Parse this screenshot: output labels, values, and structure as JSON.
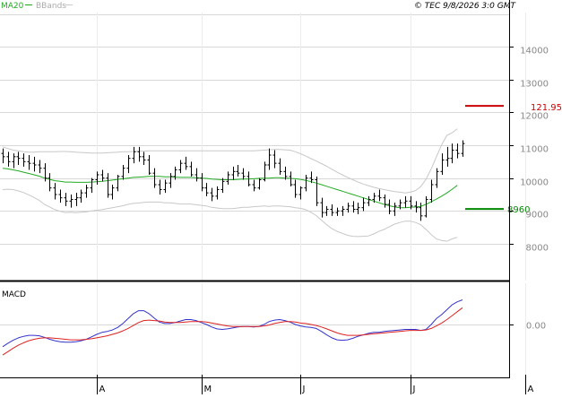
{
  "header": {
    "legend": [
      {
        "name": "MA20",
        "color": "#22aa22"
      },
      {
        "name": "BBands",
        "color": "#bbbbbb"
      }
    ],
    "watermark": "© TEC 9/8/2026 3:0 GMT"
  },
  "chart_data": [
    {
      "type": "ohlc",
      "panel": "price",
      "ylim": [
        7500,
        15000
      ],
      "y_ticks": [
        {
          "v": 8000,
          "label": "8000"
        },
        {
          "v": 9000,
          "label": "9000"
        },
        {
          "v": 10000,
          "label": "10000"
        },
        {
          "v": 11000,
          "label": "11000"
        },
        {
          "v": 12000,
          "label": "12000"
        },
        {
          "v": 13000,
          "label": "13000"
        },
        {
          "v": 14000,
          "label": "14000"
        }
      ],
      "x_ticks": [
        {
          "index": 18,
          "label": "A"
        },
        {
          "index": 38,
          "label": "M"
        },
        {
          "index": 57,
          "label": "J"
        },
        {
          "index": 78,
          "label": "J"
        },
        {
          "index": 100,
          "label": "A"
        }
      ],
      "ohlc": [
        [
          10750,
          10900,
          10450,
          10650
        ],
        [
          10650,
          10800,
          10350,
          10500
        ],
        [
          10500,
          10750,
          10300,
          10650
        ],
        [
          10650,
          10800,
          10400,
          10600
        ],
        [
          10600,
          10750,
          10350,
          10500
        ],
        [
          10500,
          10700,
          10250,
          10450
        ],
        [
          10450,
          10650,
          10200,
          10400
        ],
        [
          10400,
          10550,
          10150,
          10300
        ],
        [
          10300,
          10450,
          9900,
          10000
        ],
        [
          10000,
          10150,
          9600,
          9700
        ],
        [
          9700,
          9850,
          9350,
          9500
        ],
        [
          9500,
          9650,
          9250,
          9400
        ],
        [
          9400,
          9550,
          9150,
          9300
        ],
        [
          9300,
          9500,
          9100,
          9350
        ],
        [
          9350,
          9550,
          9150,
          9400
        ],
        [
          9400,
          9650,
          9250,
          9550
        ],
        [
          9550,
          9800,
          9400,
          9700
        ],
        [
          9700,
          10000,
          9550,
          9950
        ],
        [
          9950,
          10200,
          9800,
          10100
        ],
        [
          10100,
          10250,
          9900,
          10000
        ],
        [
          10000,
          10150,
          9400,
          9500
        ],
        [
          9500,
          9800,
          9350,
          9700
        ],
        [
          9700,
          10100,
          9600,
          10050
        ],
        [
          10050,
          10400,
          9950,
          10300
        ],
        [
          10300,
          10700,
          10150,
          10600
        ],
        [
          10600,
          10950,
          10450,
          10800
        ],
        [
          10800,
          10950,
          10500,
          10650
        ],
        [
          10650,
          10800,
          10400,
          10550
        ],
        [
          10550,
          10700,
          10100,
          10150
        ],
        [
          10150,
          10300,
          9700,
          9800
        ],
        [
          9800,
          9950,
          9500,
          9650
        ],
        [
          9650,
          9950,
          9550,
          9850
        ],
        [
          9850,
          10150,
          9700,
          10050
        ],
        [
          10050,
          10350,
          9950,
          10250
        ],
        [
          10250,
          10550,
          10150,
          10450
        ],
        [
          10450,
          10650,
          10250,
          10350
        ],
        [
          10350,
          10500,
          10050,
          10100
        ],
        [
          10100,
          10300,
          9900,
          10000
        ],
        [
          10000,
          10150,
          9600,
          9700
        ],
        [
          9700,
          9850,
          9450,
          9550
        ],
        [
          9550,
          9700,
          9300,
          9450
        ],
        [
          9450,
          9750,
          9350,
          9650
        ],
        [
          9650,
          10000,
          9550,
          9900
        ],
        [
          9900,
          10200,
          9800,
          10100
        ],
        [
          10100,
          10350,
          9950,
          10200
        ],
        [
          10200,
          10400,
          10050,
          10150
        ],
        [
          10150,
          10300,
          9950,
          10050
        ],
        [
          10050,
          10200,
          9750,
          9800
        ],
        [
          9800,
          9950,
          9600,
          9700
        ],
        [
          9700,
          10000,
          9650,
          9950
        ],
        [
          9950,
          10500,
          9900,
          10400
        ],
        [
          10400,
          10900,
          10250,
          10700
        ],
        [
          10700,
          10850,
          10300,
          10450
        ],
        [
          10450,
          10600,
          10100,
          10200
        ],
        [
          10200,
          10350,
          9950,
          10050
        ],
        [
          10050,
          10200,
          9750,
          9800
        ],
        [
          9800,
          9950,
          9400,
          9500
        ],
        [
          9500,
          9750,
          9350,
          9700
        ],
        [
          9700,
          10100,
          9600,
          10000
        ],
        [
          10000,
          10200,
          9850,
          9950
        ],
        [
          9950,
          10050,
          9150,
          9250
        ],
        [
          9250,
          9400,
          8800,
          8950
        ],
        [
          8950,
          9150,
          8850,
          9050
        ],
        [
          9050,
          9200,
          8850,
          8950
        ],
        [
          8950,
          9100,
          8850,
          9000
        ],
        [
          9000,
          9150,
          8850,
          9050
        ],
        [
          9050,
          9250,
          8950,
          9150
        ],
        [
          9150,
          9300,
          8950,
          9050
        ],
        [
          9050,
          9250,
          8900,
          9100
        ],
        [
          9100,
          9400,
          9000,
          9250
        ],
        [
          9250,
          9450,
          9150,
          9350
        ],
        [
          9350,
          9550,
          9250,
          9450
        ],
        [
          9450,
          9650,
          9300,
          9400
        ],
        [
          9400,
          9500,
          9100,
          9200
        ],
        [
          9200,
          9350,
          8900,
          9000
        ],
        [
          9000,
          9250,
          8850,
          9150
        ],
        [
          9150,
          9350,
          9050,
          9250
        ],
        [
          9250,
          9450,
          9100,
          9300
        ],
        [
          9300,
          9450,
          9050,
          9150
        ],
        [
          9150,
          9300,
          8950,
          9100
        ],
        [
          9100,
          9250,
          8700,
          8850
        ],
        [
          8850,
          9450,
          8800,
          9350
        ],
        [
          9350,
          9950,
          9250,
          9800
        ],
        [
          9800,
          10300,
          9700,
          10200
        ],
        [
          10200,
          10750,
          10100,
          10550
        ],
        [
          10550,
          10950,
          10350,
          10600
        ],
        [
          10600,
          11050,
          10450,
          10850
        ],
        [
          10850,
          11050,
          10600,
          10750
        ],
        [
          10750,
          11150,
          10650,
          11050
        ]
      ],
      "ma20": [
        10300,
        10280,
        10250,
        10220,
        10180,
        10140,
        10100,
        10060,
        10000,
        9960,
        9920,
        9900,
        9880,
        9880,
        9870,
        9870,
        9870,
        9880,
        9890,
        9900,
        9920,
        9940,
        9960,
        9980,
        10000,
        10020,
        10030,
        10040,
        10050,
        10050,
        10050,
        10040,
        10040,
        10030,
        10020,
        10020,
        10020,
        10010,
        10000,
        9990,
        9970,
        9960,
        9950,
        9950,
        9950,
        9960,
        9970,
        9970,
        9980,
        9990,
        10000,
        10000,
        10010,
        10010,
        10000,
        9990,
        9980,
        9960,
        9930,
        9890,
        9850,
        9800,
        9750,
        9700,
        9650,
        9600,
        9550,
        9500,
        9450,
        9400,
        9350,
        9300,
        9250,
        9200,
        9160,
        9120,
        9100,
        9100,
        9110,
        9120,
        9140,
        9200,
        9280,
        9360,
        9450,
        9550,
        9660,
        9780
      ],
      "bb_upper": [
        10950,
        10900,
        10850,
        10830,
        10800,
        10790,
        10790,
        10800,
        10800,
        10800,
        10800,
        10810,
        10810,
        10800,
        10790,
        10780,
        10770,
        10760,
        10760,
        10760,
        10770,
        10780,
        10790,
        10800,
        10800,
        10810,
        10820,
        10820,
        10830,
        10830,
        10830,
        10830,
        10830,
        10830,
        10830,
        10830,
        10830,
        10830,
        10830,
        10830,
        10830,
        10830,
        10830,
        10830,
        10830,
        10830,
        10830,
        10830,
        10830,
        10840,
        10850,
        10860,
        10870,
        10870,
        10860,
        10850,
        10800,
        10740,
        10670,
        10590,
        10520,
        10440,
        10360,
        10270,
        10180,
        10100,
        10020,
        9950,
        9880,
        9820,
        9770,
        9720,
        9680,
        9650,
        9620,
        9590,
        9570,
        9550,
        9570,
        9620,
        9740,
        9960,
        10280,
        10650,
        11010,
        11300,
        11380,
        11500
      ],
      "bb_lower": [
        9650,
        9660,
        9650,
        9610,
        9560,
        9490,
        9410,
        9320,
        9200,
        9120,
        9040,
        8990,
        8950,
        8960,
        8950,
        8960,
        8970,
        9000,
        9020,
        9040,
        9070,
        9100,
        9130,
        9160,
        9200,
        9230,
        9240,
        9260,
        9270,
        9270,
        9270,
        9250,
        9250,
        9230,
        9210,
        9210,
        9210,
        9190,
        9170,
        9150,
        9110,
        9090,
        9070,
        9070,
        9070,
        9090,
        9110,
        9110,
        9130,
        9140,
        9150,
        9140,
        9150,
        9150,
        9140,
        9130,
        9100,
        9080,
        9040,
        8960,
        8860,
        8720,
        8580,
        8460,
        8380,
        8320,
        8260,
        8230,
        8220,
        8230,
        8240,
        8300,
        8380,
        8440,
        8520,
        8600,
        8650,
        8690,
        8690,
        8650,
        8580,
        8440,
        8280,
        8150,
        8100,
        8080,
        8150,
        8200
      ]
    },
    {
      "type": "line",
      "panel": "macd",
      "title": "MACD",
      "ylim": [
        -1,
        1
      ],
      "y_ticks": [
        {
          "v": 0,
          "label": "0.00"
        }
      ],
      "series": [
        {
          "color": "#3333cc",
          "values": [
            -0.45,
            -0.38,
            -0.32,
            -0.27,
            -0.24,
            -0.22,
            -0.22,
            -0.23,
            -0.26,
            -0.3,
            -0.33,
            -0.35,
            -0.36,
            -0.36,
            -0.35,
            -0.33,
            -0.3,
            -0.25,
            -0.2,
            -0.16,
            -0.14,
            -0.11,
            -0.06,
            0.02,
            0.12,
            0.22,
            0.28,
            0.28,
            0.22,
            0.13,
            0.05,
            0.02,
            0.02,
            0.04,
            0.07,
            0.1,
            0.1,
            0.08,
            0.04,
            0.0,
            -0.05,
            -0.09,
            -0.1,
            -0.09,
            -0.07,
            -0.05,
            -0.04,
            -0.04,
            -0.05,
            -0.04,
            0.0,
            0.06,
            0.09,
            0.1,
            0.08,
            0.05,
            0.0,
            -0.03,
            -0.05,
            -0.06,
            -0.08,
            -0.14,
            -0.21,
            -0.27,
            -0.31,
            -0.32,
            -0.31,
            -0.28,
            -0.24,
            -0.21,
            -0.18,
            -0.16,
            -0.16,
            -0.14,
            -0.13,
            -0.12,
            -0.11,
            -0.1,
            -0.1,
            -0.1,
            -0.12,
            -0.1,
            0.0,
            0.12,
            0.2,
            0.3,
            0.4,
            0.46,
            0.5
          ]
        },
        {
          "color": "#dd2222",
          "values": [
            -0.62,
            -0.55,
            -0.48,
            -0.42,
            -0.37,
            -0.33,
            -0.3,
            -0.28,
            -0.27,
            -0.27,
            -0.28,
            -0.29,
            -0.3,
            -0.31,
            -0.31,
            -0.31,
            -0.3,
            -0.29,
            -0.27,
            -0.25,
            -0.23,
            -0.2,
            -0.17,
            -0.13,
            -0.08,
            -0.02,
            0.04,
            0.08,
            0.09,
            0.08,
            0.07,
            0.05,
            0.04,
            0.04,
            0.04,
            0.05,
            0.06,
            0.06,
            0.06,
            0.05,
            0.03,
            0.01,
            -0.01,
            -0.03,
            -0.04,
            -0.04,
            -0.04,
            -0.04,
            -0.04,
            -0.04,
            -0.03,
            -0.01,
            0.02,
            0.04,
            0.06,
            0.06,
            0.05,
            0.03,
            0.02,
            0.0,
            -0.02,
            -0.05,
            -0.09,
            -0.13,
            -0.17,
            -0.2,
            -0.22,
            -0.22,
            -0.22,
            -0.21,
            -0.2,
            -0.19,
            -0.18,
            -0.17,
            -0.16,
            -0.15,
            -0.14,
            -0.13,
            -0.12,
            -0.12,
            -0.12,
            -0.11,
            -0.08,
            -0.03,
            0.03,
            0.1,
            0.18,
            0.26,
            0.34
          ]
        }
      ]
    }
  ],
  "annotations": [
    {
      "label": "121.95",
      "value": 12195,
      "color": "#cc0000"
    },
    {
      "label": "8960",
      "value": 9060,
      "color": "#008800"
    }
  ]
}
